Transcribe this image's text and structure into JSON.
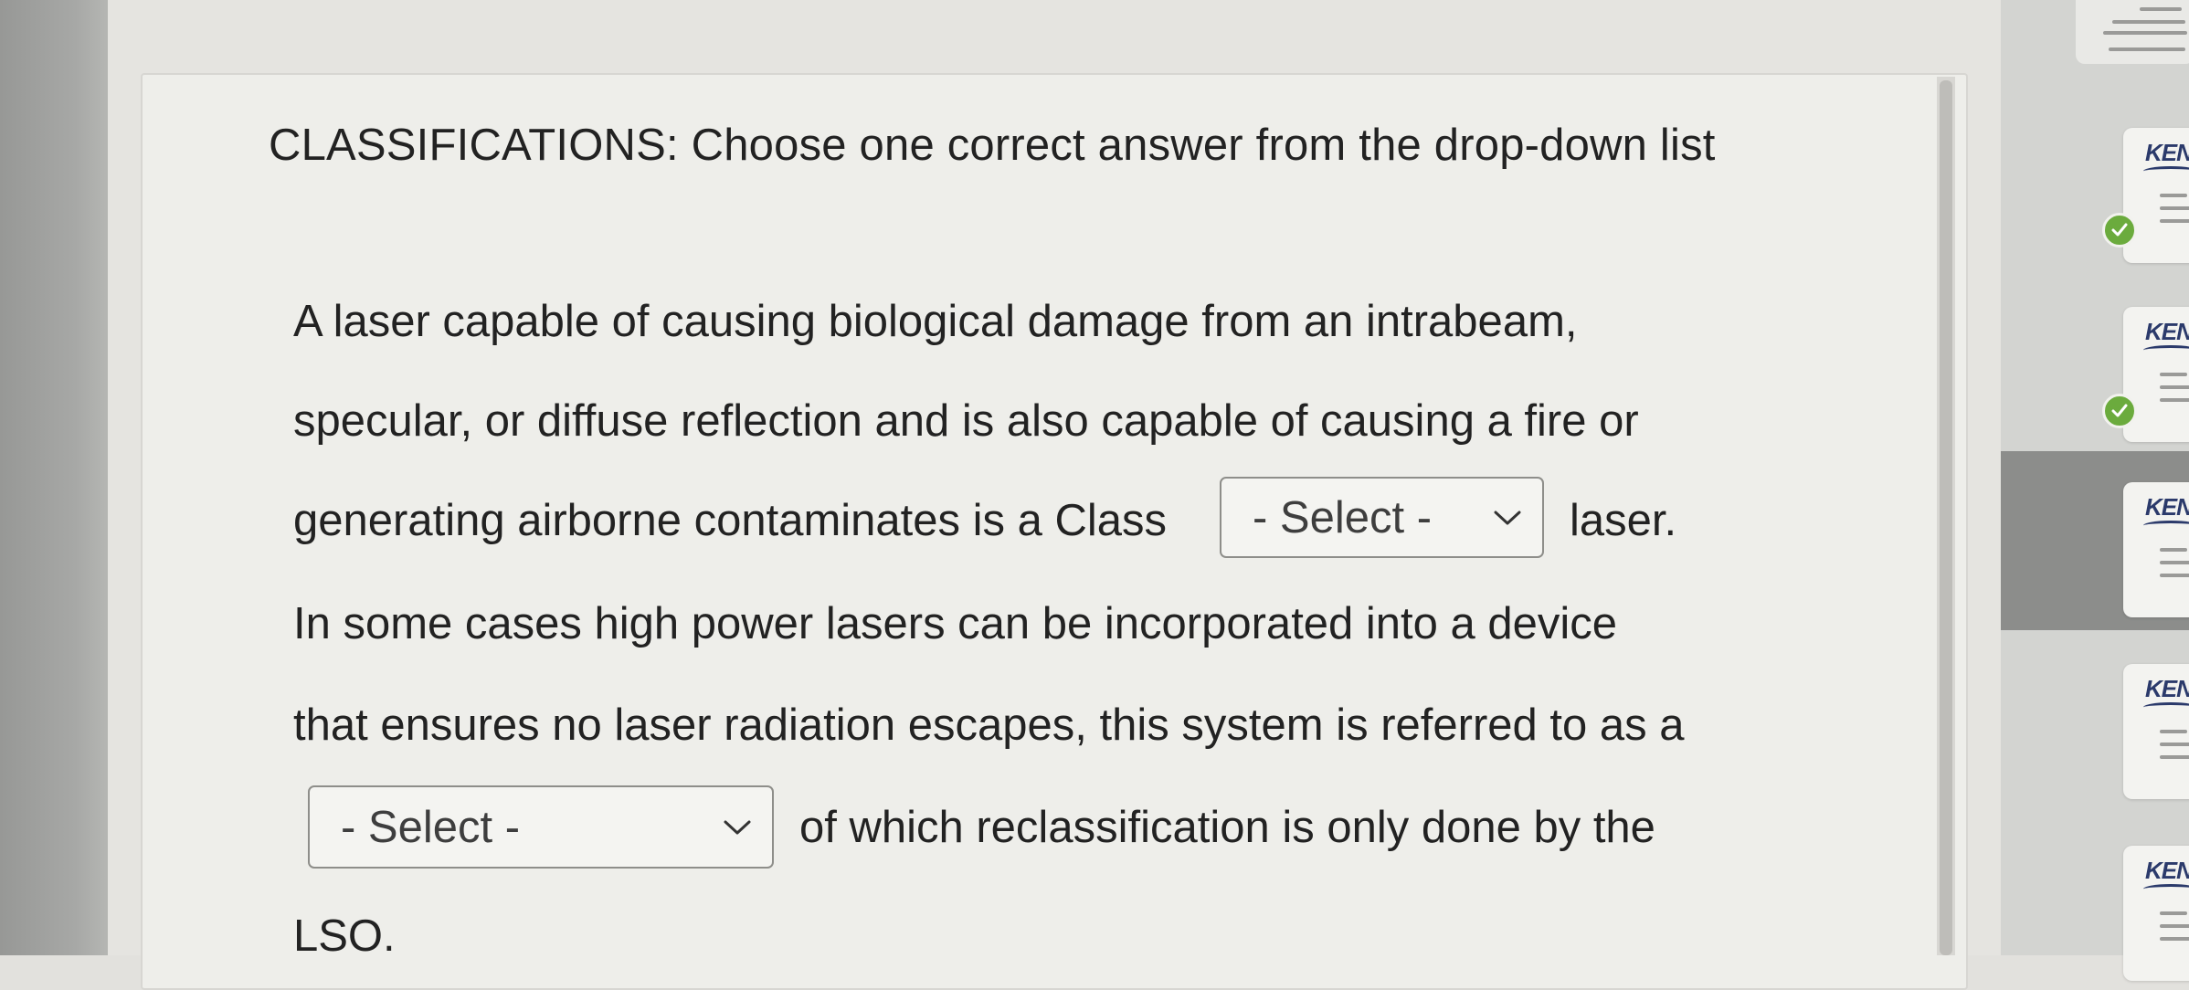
{
  "question": {
    "heading": "CLASSIFICATIONS: Choose one correct answer from the drop-down list",
    "line1": "A laser capable of causing biological damage from an intrabeam,",
    "line2": "specular, or diffuse reflection and is also capable of causing a fire or",
    "line3_before": "generating airborne contaminates is a Class",
    "line3_after": "laser.",
    "line4": "In some cases high power lasers can be incorporated into a device",
    "line5": "that ensures no laser radiation escapes, this system is referred to as a",
    "line6_after": "of which reclassification is only done by the",
    "line7": "LSO."
  },
  "dropdowns": [
    {
      "selected": "- Select -"
    },
    {
      "selected": "- Select -"
    }
  ],
  "sidebar": {
    "thumbnails": [
      {
        "logo": "KEN",
        "completed": true
      },
      {
        "logo": "KEN",
        "completed": true
      },
      {
        "logo": "KEN",
        "completed": false,
        "selected": true
      },
      {
        "logo": "KEN",
        "completed": false
      },
      {
        "logo": "KEN",
        "completed": false
      }
    ]
  },
  "colors": {
    "check": "#6bab3d",
    "logo": "#2b3a6b",
    "selected_bg": "#8c8d8b"
  },
  "icons": {
    "dropdown": "chevron-down-icon",
    "completed": "checkmark-icon"
  }
}
